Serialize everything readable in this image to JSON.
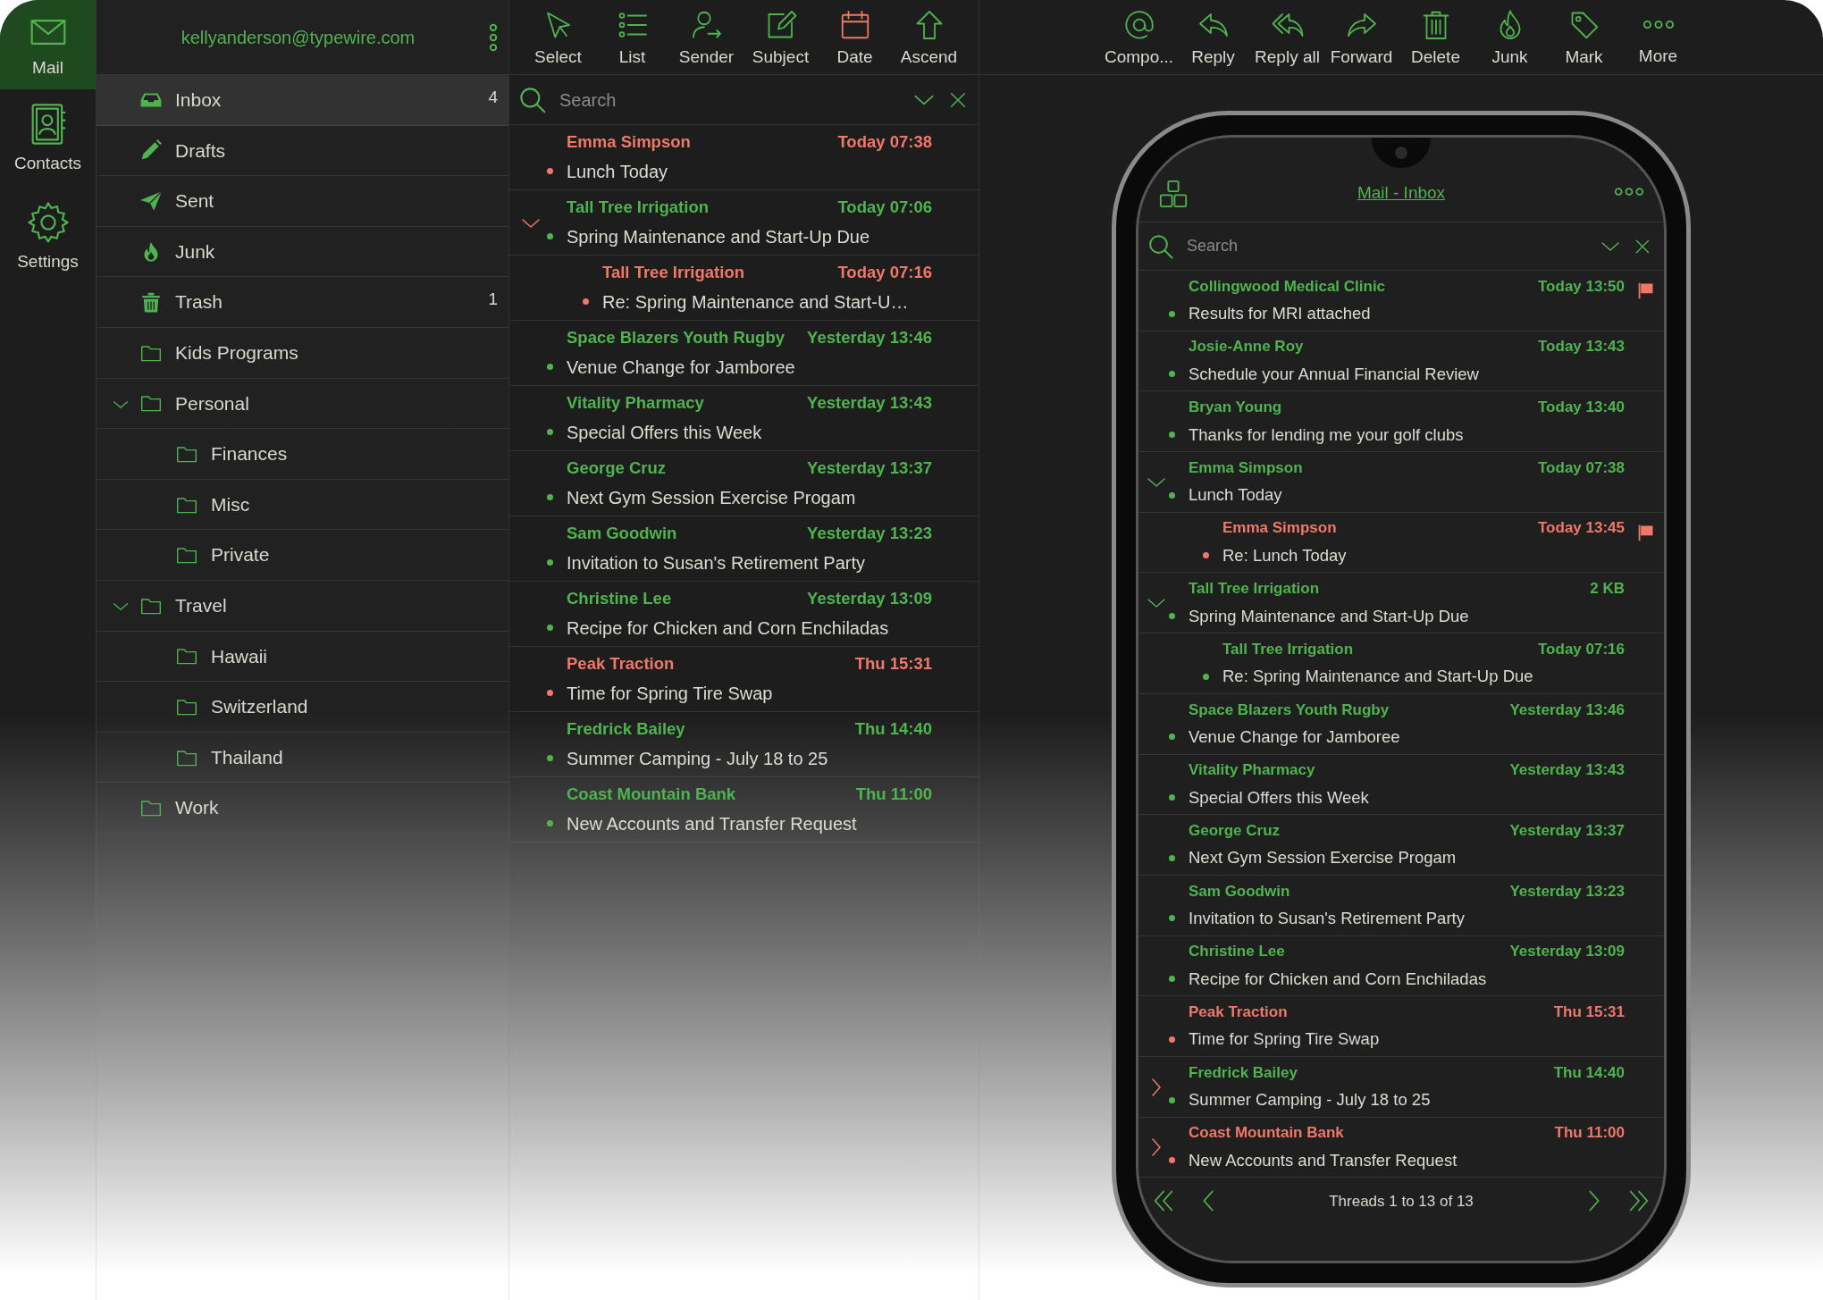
{
  "rail": [
    {
      "label": "Mail",
      "kind": "mail",
      "selected": true
    },
    {
      "label": "Contacts",
      "kind": "contacts",
      "selected": false
    },
    {
      "label": "Settings",
      "kind": "settings",
      "selected": false
    }
  ],
  "account": {
    "email": "kellyanderson@typewire.com"
  },
  "folders": [
    {
      "label": "Inbox",
      "kind": "inbox",
      "count": "4",
      "selected": true
    },
    {
      "label": "Drafts",
      "kind": "drafts",
      "selected": false
    },
    {
      "label": "Sent",
      "kind": "sent",
      "selected": false
    },
    {
      "label": "Junk",
      "kind": "flame",
      "selected": false
    },
    {
      "label": "Trash",
      "kind": "trash",
      "count": "1",
      "selected": false
    },
    {
      "label": "Kids Programs",
      "kind": "folder",
      "selected": false
    },
    {
      "label": "Personal",
      "kind": "folder",
      "selected": false,
      "expanded": true,
      "children": [
        {
          "label": "Finances",
          "kind": "folder",
          "selected": false
        },
        {
          "label": "Misc",
          "kind": "folder",
          "selected": false
        },
        {
          "label": "Private",
          "kind": "folder",
          "selected": false
        }
      ]
    },
    {
      "label": "Travel",
      "kind": "folder",
      "selected": false,
      "expanded": true,
      "children": [
        {
          "label": "Hawaii",
          "kind": "folder",
          "selected": false
        },
        {
          "label": "Switzerland",
          "kind": "folder",
          "selected": false
        },
        {
          "label": "Thailand",
          "kind": "folder",
          "selected": false
        }
      ]
    },
    {
      "label": "Work",
      "kind": "folder",
      "selected": false
    }
  ],
  "sort_toolbar": [
    {
      "label": "Select",
      "kind": "select"
    },
    {
      "label": "List",
      "kind": "list"
    },
    {
      "label": "Sender",
      "kind": "sender"
    },
    {
      "label": "Subject",
      "kind": "subject"
    },
    {
      "label": "Date",
      "kind": "date"
    },
    {
      "label": "Ascend",
      "kind": "ascend"
    }
  ],
  "list_search": {
    "placeholder": "Search"
  },
  "messages": [
    {
      "sender": "Emma Simpson",
      "time": "Today 07:38",
      "subject": "Lunch Today",
      "color": "#f07868"
    },
    {
      "sender": "Tall Tree Irrigation",
      "time": "Today 07:06",
      "subject": "Spring Maintenance and Start-Up Due",
      "color": "#4fb34f",
      "expanded": true,
      "children": [
        {
          "sender": "Tall Tree Irrigation",
          "time": "Today 07:16",
          "subject": "Re: Spring Maintenance and Start-U…",
          "color": "#f07868"
        }
      ]
    },
    {
      "sender": "Space Blazers Youth Rugby",
      "time": "Yesterday 13:46",
      "subject": "Venue Change for Jamboree",
      "color": "#4fb34f"
    },
    {
      "sender": "Vitality Pharmacy",
      "time": "Yesterday 13:43",
      "subject": "Special Offers this Week",
      "color": "#4fb34f"
    },
    {
      "sender": "George Cruz",
      "time": "Yesterday 13:37",
      "subject": "Next Gym Session Exercise Progam",
      "color": "#4fb34f"
    },
    {
      "sender": "Sam Goodwin",
      "time": "Yesterday 13:23",
      "subject": "Invitation to Susan's Retirement Party",
      "color": "#4fb34f"
    },
    {
      "sender": "Christine Lee",
      "time": "Yesterday 13:09",
      "subject": "Recipe for Chicken and Corn Enchiladas",
      "color": "#4fb34f"
    },
    {
      "sender": "Peak Traction",
      "time": "Thu 15:31",
      "subject": "Time for Spring Tire Swap",
      "color": "#f07868"
    },
    {
      "sender": "Fredrick Bailey",
      "time": "Thu 14:40",
      "subject": "Summer Camping - July 18 to 25",
      "color": "#4fb34f"
    },
    {
      "sender": "Coast Mountain Bank",
      "time": "Thu 11:00",
      "subject": "New Accounts and Transfer Request",
      "color": "#4fb34f"
    }
  ],
  "action_toolbar": [
    {
      "label": "Compo...",
      "kind": "compose"
    },
    {
      "label": "Reply",
      "kind": "reply"
    },
    {
      "label": "Reply all",
      "kind": "replyall"
    },
    {
      "label": "Forward",
      "kind": "forward"
    },
    {
      "label": "Delete",
      "kind": "delete"
    },
    {
      "label": "Junk",
      "kind": "junk"
    },
    {
      "label": "Mark",
      "kind": "mark"
    },
    {
      "label": "More",
      "kind": "more"
    }
  ],
  "phone": {
    "title": "Mail - Inbox",
    "search": {
      "placeholder": "Search"
    },
    "messages": [
      {
        "sender": "Collingwood Medical Clinic",
        "time": "Today 13:50",
        "subject": "Results for MRI attached",
        "color": "#4fb34f",
        "flagged": true
      },
      {
        "sender": "Josie-Anne Roy",
        "time": "Today 13:43",
        "subject": "Schedule your Annual Financial Review",
        "color": "#4fb34f",
        "flagged": false
      },
      {
        "sender": "Bryan Young",
        "time": "Today 13:40",
        "subject": "Thanks for lending me your golf clubs",
        "color": "#4fb34f",
        "flagged": false
      },
      {
        "sender": "Emma Simpson",
        "time": "Today 07:38",
        "subject": "Lunch Today",
        "color": "#4fb34f",
        "flagged": false,
        "expanded": true,
        "children": [
          {
            "sender": "Emma Simpson",
            "time": "Today 13:45",
            "subject": "Re: Lunch Today",
            "color": "#f07868",
            "flagged": true
          }
        ]
      },
      {
        "sender": "Tall Tree Irrigation",
        "time": "2 KB",
        "subject": "Spring Maintenance and Start-Up Due",
        "color": "#4fb34f",
        "flagged": false,
        "expanded": true,
        "children": [
          {
            "sender": "Tall Tree Irrigation",
            "time": "Today 07:16",
            "subject": "Re: Spring Maintenance and Start-Up Due",
            "color": "#4fb34f",
            "flagged": false
          }
        ]
      },
      {
        "sender": "Space Blazers Youth Rugby",
        "time": "Yesterday 13:46",
        "subject": "Venue Change for Jamboree",
        "color": "#4fb34f",
        "flagged": false
      },
      {
        "sender": "Vitality Pharmacy",
        "time": "Yesterday 13:43",
        "subject": "Special Offers this Week",
        "color": "#4fb34f",
        "flagged": false
      },
      {
        "sender": "George Cruz",
        "time": "Yesterday 13:37",
        "subject": "Next Gym Session Exercise Progam",
        "color": "#4fb34f",
        "flagged": false
      },
      {
        "sender": "Sam Goodwin",
        "time": "Yesterday 13:23",
        "subject": "Invitation to Susan's Retirement Party",
        "color": "#4fb34f",
        "flagged": false
      },
      {
        "sender": "Christine Lee",
        "time": "Yesterday 13:09",
        "subject": "Recipe for Chicken and Corn Enchiladas",
        "color": "#4fb34f",
        "flagged": false
      },
      {
        "sender": "Peak Traction",
        "time": "Thu 15:31",
        "subject": "Time for Spring Tire Swap",
        "color": "#f07868",
        "flagged": false
      },
      {
        "sender": "Fredrick Bailey",
        "time": "Thu 14:40",
        "subject": "Summer Camping - July 18 to 25",
        "color": "#4fb34f",
        "flagged": false,
        "expanded": false
      },
      {
        "sender": "Coast Mountain Bank",
        "time": "Thu 11:00",
        "subject": "New Accounts and Transfer Request",
        "color": "#f07868",
        "flagged": false,
        "expanded": false
      }
    ],
    "pager": {
      "label": "Threads 1 to 13 of 13"
    }
  }
}
